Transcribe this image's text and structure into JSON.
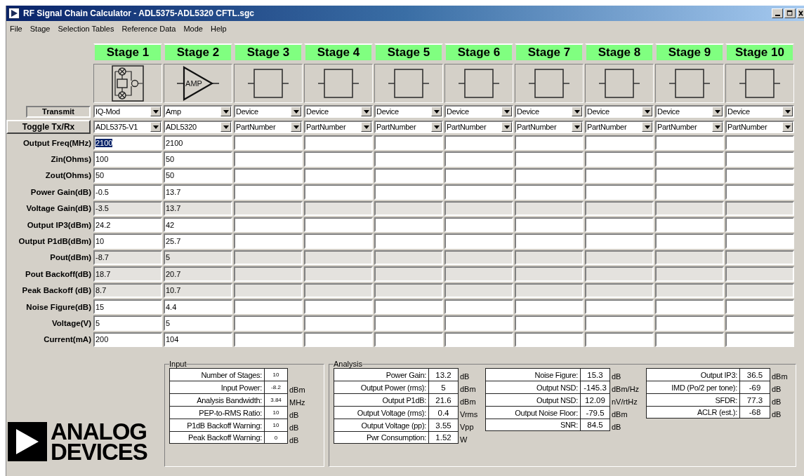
{
  "window": {
    "title": "RF Signal Chain Calculator - ADL5375-ADL5320 CFTL.sgc"
  },
  "menu": [
    "File",
    "Stage",
    "Selection Tables",
    "Reference Data",
    "Mode",
    "Help"
  ],
  "mode_indicator": "Transmit",
  "toggle_button": "Toggle Tx/Rx",
  "stages": [
    {
      "label": "Stage 1",
      "kind": "iq-mod",
      "type": "IQ-Mod",
      "part": "ADL5375-V1"
    },
    {
      "label": "Stage 2",
      "kind": "amp",
      "icon_label": "AMP",
      "type": "Amp",
      "part": "ADL5320"
    },
    {
      "label": "Stage 3",
      "kind": "device",
      "type": "Device",
      "part": "PartNumber"
    },
    {
      "label": "Stage 4",
      "kind": "device",
      "type": "Device",
      "part": "PartNumber"
    },
    {
      "label": "Stage 5",
      "kind": "device",
      "type": "Device",
      "part": "PartNumber"
    },
    {
      "label": "Stage 6",
      "kind": "device",
      "type": "Device",
      "part": "PartNumber"
    },
    {
      "label": "Stage 7",
      "kind": "device",
      "type": "Device",
      "part": "PartNumber"
    },
    {
      "label": "Stage 8",
      "kind": "device",
      "type": "Device",
      "part": "PartNumber"
    },
    {
      "label": "Stage 9",
      "kind": "device",
      "type": "Device",
      "part": "PartNumber"
    },
    {
      "label": "Stage 10",
      "kind": "device",
      "type": "Device",
      "part": "PartNumber"
    }
  ],
  "parameters": [
    {
      "label": "Output Freq(MHz)",
      "readonly": false,
      "cells": [
        {
          "text": "2100",
          "selected": true
        },
        {
          "text": "2100",
          "selected": false
        }
      ]
    },
    {
      "label": "Zin(Ohms)",
      "readonly": false,
      "cells": [
        {
          "text": "100",
          "selected": false
        },
        {
          "text": "50",
          "selected": false
        }
      ]
    },
    {
      "label": "Zout(Ohms)",
      "readonly": false,
      "cells": [
        {
          "text": "50",
          "selected": false
        },
        {
          "text": "50",
          "selected": false
        }
      ]
    },
    {
      "label": "Power Gain(dB)",
      "readonly": false,
      "cells": [
        {
          "text": "-0.5",
          "selected": false
        },
        {
          "text": "13.7",
          "selected": false
        }
      ]
    },
    {
      "label": "Voltage Gain(dB)",
      "readonly": true,
      "cells": [
        {
          "text": "-3.5",
          "selected": false
        },
        {
          "text": "13.7",
          "selected": false
        }
      ]
    },
    {
      "label": "Output IP3(dBm)",
      "readonly": false,
      "cells": [
        {
          "text": "24.2",
          "selected": false
        },
        {
          "text": "42",
          "selected": false
        }
      ]
    },
    {
      "label": "Output P1dB(dBm)",
      "readonly": false,
      "cells": [
        {
          "text": "10",
          "selected": false
        },
        {
          "text": "25.7",
          "selected": false
        }
      ]
    },
    {
      "label": "Pout(dBm)",
      "readonly": true,
      "cells": [
        {
          "text": "-8.7",
          "selected": false
        },
        {
          "text": "5",
          "selected": false
        }
      ]
    },
    {
      "label": "Pout Backoff(dB)",
      "readonly": true,
      "cells": [
        {
          "text": "18.7",
          "selected": false
        },
        {
          "text": "20.7",
          "selected": false
        }
      ]
    },
    {
      "label": "Peak Backoff (dB)",
      "readonly": true,
      "cells": [
        {
          "text": "8.7",
          "selected": false
        },
        {
          "text": "10.7",
          "selected": false
        }
      ]
    },
    {
      "label": "Noise Figure(dB)",
      "readonly": false,
      "cells": [
        {
          "text": "15",
          "selected": false
        },
        {
          "text": "4.4",
          "selected": false
        }
      ]
    },
    {
      "label": "Voltage(V)",
      "readonly": false,
      "cells": [
        {
          "text": "5",
          "selected": false
        },
        {
          "text": "5",
          "selected": false
        }
      ]
    },
    {
      "label": "Current(mA)",
      "readonly": false,
      "cells": [
        {
          "text": "200",
          "selected": false
        },
        {
          "text": "104",
          "selected": false
        }
      ]
    }
  ],
  "input_panel": {
    "title": "Input",
    "rows": [
      {
        "label": "Number of Stages:",
        "value": "10"
      },
      {
        "label": "Input Power:",
        "value": "-8.2",
        "unit": "dBm"
      },
      {
        "label": "Analysis Bandwidth:",
        "value": "3.84",
        "unit": "MHz"
      },
      {
        "label": "PEP-to-RMS Ratio:",
        "value": "10",
        "unit": "dB"
      },
      {
        "label": "P1dB Backoff Warning:",
        "value": "10",
        "unit": "dB"
      },
      {
        "label": "Peak Backoff Warning:",
        "value": "0",
        "unit": "dB"
      }
    ]
  },
  "analysis_panel": {
    "title": "Analysis",
    "tables": [
      [
        {
          "label": "Power Gain:",
          "value": "13.2",
          "unit": "dB"
        },
        {
          "label": "Output Power (rms):",
          "value": "5",
          "unit": "dBm"
        },
        {
          "label": "Output P1dB:",
          "value": "21.6",
          "unit": "dBm"
        },
        {
          "label": "Output Voltage (rms):",
          "value": "0.4",
          "unit": "Vrms"
        },
        {
          "label": "Output Voltage (pp):",
          "value": "3.55",
          "unit": "Vpp"
        },
        {
          "label": "Pwr Consumption:",
          "value": "1.52",
          "unit": "W"
        }
      ],
      [
        {
          "label": "Noise Figure:",
          "value": "15.3",
          "unit": "dB"
        },
        {
          "label": "Output NSD:",
          "value": "-145.3",
          "unit": "dBm/Hz"
        },
        {
          "label": "Output NSD:",
          "value": "12.09",
          "unit": "nV/rtHz"
        },
        {
          "label": "Output Noise Floor:",
          "value": "-79.5",
          "unit": "dBm"
        },
        {
          "label": "SNR:",
          "value": "84.5",
          "unit": "dB"
        }
      ],
      [
        {
          "label": "Output IP3:",
          "value": "36.5",
          "unit": "dBm"
        },
        {
          "label": "IMD (Po/2 per tone):",
          "value": "-69",
          "unit": "dB"
        },
        {
          "label": "SFDR:",
          "value": "77.3",
          "unit": "dB"
        },
        {
          "label": "ACLR (est.):",
          "value": "-68",
          "unit": "dB"
        }
      ]
    ]
  },
  "logo": {
    "line_1": "ANALOG",
    "line_2": "DEVICES"
  }
}
